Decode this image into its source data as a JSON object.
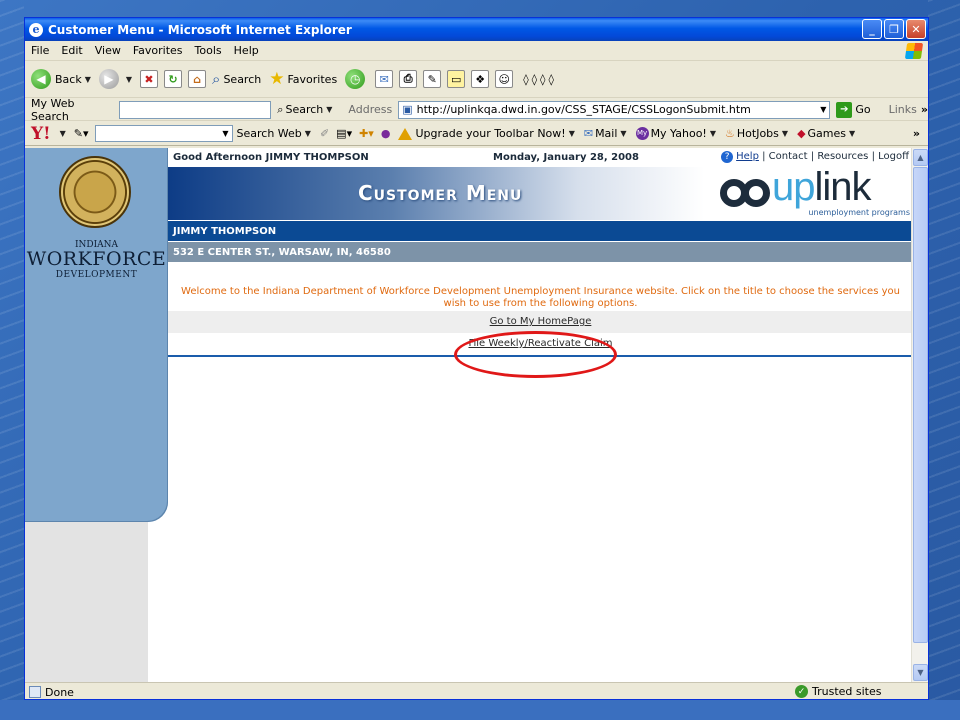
{
  "window": {
    "title": "Customer Menu - Microsoft Internet Explorer"
  },
  "menubar": {
    "items": [
      "File",
      "Edit",
      "View",
      "Favorites",
      "Tools",
      "Help"
    ]
  },
  "toolbar": {
    "back": "Back",
    "search": "Search",
    "favorites": "Favorites"
  },
  "mywebsearch": {
    "label": "My Web Search",
    "search_button": "Search",
    "address_label": "Address",
    "url": "http://uplinkqa.dwd.in.gov/CSS_STAGE/CSSLogonSubmit.htm",
    "go": "Go",
    "links": "Links"
  },
  "yahoo": {
    "logo": "Y!",
    "search_web": "Search Web",
    "upgrade": "Upgrade your Toolbar Now!",
    "mail": "Mail",
    "my_yahoo": "My Yahoo!",
    "hotjobs": "HotJobs",
    "games": "Games"
  },
  "brand": {
    "line1": "INDIANA",
    "line2": "WORKFORCE",
    "line3": "DEVELOPMENT"
  },
  "page": {
    "greeting": "Good Afternoon JIMMY THOMPSON",
    "date": "Monday, January 28, 2008",
    "links": {
      "help": "Help",
      "contact": "Contact",
      "resources": "Resources",
      "logoff": "Logoff"
    },
    "banner_title": "Customer Menu",
    "uplink_logo": {
      "up": "up",
      "link": "link",
      "sub": "unemployment programs"
    },
    "name": "JIMMY THOMPSON",
    "address": "532 E CENTER ST., WARSAW, IN, 46580",
    "welcome": "Welcome to the Indiana Department of Workforce Development Unemployment Insurance website. Click on the title to choose the services you wish to use from the following options.",
    "options": [
      "Go to My HomePage",
      "File Weekly/Reactivate Claim"
    ]
  },
  "status": {
    "left": "Done",
    "zone": "Trusted sites"
  },
  "colors": {
    "titlebar": "#0058e6",
    "name_bar": "#0b4a94",
    "address_bar": "#7d93a8",
    "welcome_text": "#e06a10",
    "annotation": "#e01818"
  }
}
